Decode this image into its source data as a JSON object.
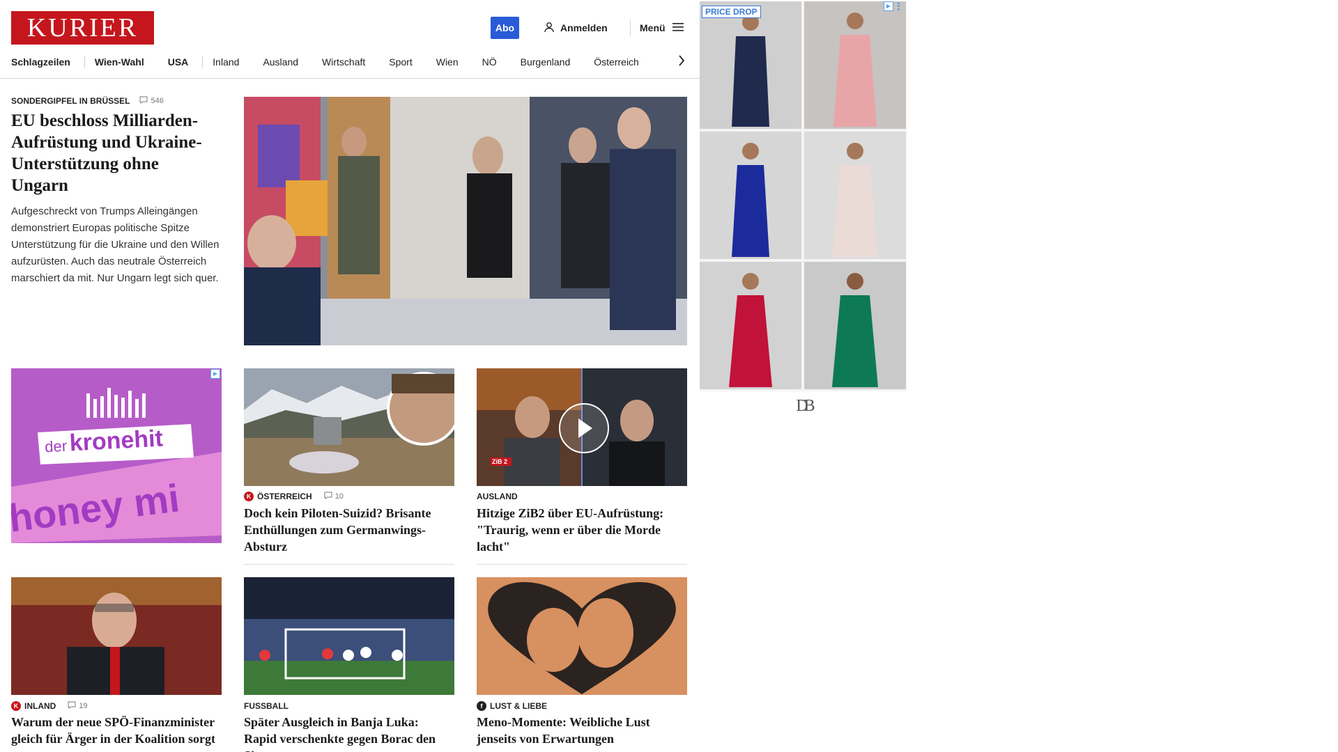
{
  "header": {
    "logo": "KURIER",
    "abo_label": "Abo",
    "login_label": "Anmelden",
    "menu_label": "Menü"
  },
  "nav": {
    "items": [
      "Schlagzeilen",
      "Wien-Wahl",
      "USA",
      "Inland",
      "Ausland",
      "Wirtschaft",
      "Sport",
      "Wien",
      "NÖ",
      "Burgenland",
      "Österreich"
    ]
  },
  "lead": {
    "kicker": "SONDERGIPFEL IN BRÜSSEL",
    "comments": "546",
    "title": "EU beschloss Milliarden-Aufrüstung und Ukraine-Unterstützung ohne Ungarn",
    "text": "Aufgeschreckt von Trumps Alleingängen demonstriert Europas politische Spitze Unterstützung für die Ukraine und den Willen aufzurüsten. Auch das neutrale Österreich marschiert da mit. Nur Ungarn legt sich quer."
  },
  "ad_left": {
    "brand_small": "der",
    "brand_big": "kronehit",
    "tagline": "honey mi"
  },
  "cards": [
    {
      "kicker": "ÖSTERREICH",
      "brand": "K",
      "comments": "10",
      "title": "Doch kein Piloten-Suizid? Brisante Enthüllungen zum Germanwings-Absturz"
    },
    {
      "kicker": "AUSLAND",
      "title": "Hitzige ZiB2 über EU-Aufrüstung: \"Traurig, wenn er über die Morde lacht\"",
      "video_badge": "ZiB 2"
    },
    {
      "kicker": "INLAND",
      "brand": "K",
      "comments": "19",
      "title": "Warum der neue SPÖ-Finanzminister gleich für Ärger in der Koalition sorgt"
    },
    {
      "kicker": "FUSSBALL",
      "title": "Später Ausgleich in Banja Luka: Rapid verschenkte gegen Borac den Sieg"
    },
    {
      "kicker": "LUST & LIEBE",
      "brand": "f",
      "title": "Meno-Momente: Weibliche Lust jenseits von Erwartungen"
    }
  ],
  "side_ad": {
    "price_drop": "PRICE DROP",
    "brand_mark": "DB"
  },
  "colors": {
    "brand_red": "#c5161d",
    "abo_blue": "#2a5bd7",
    "ad_purple": "#b65cc9"
  }
}
